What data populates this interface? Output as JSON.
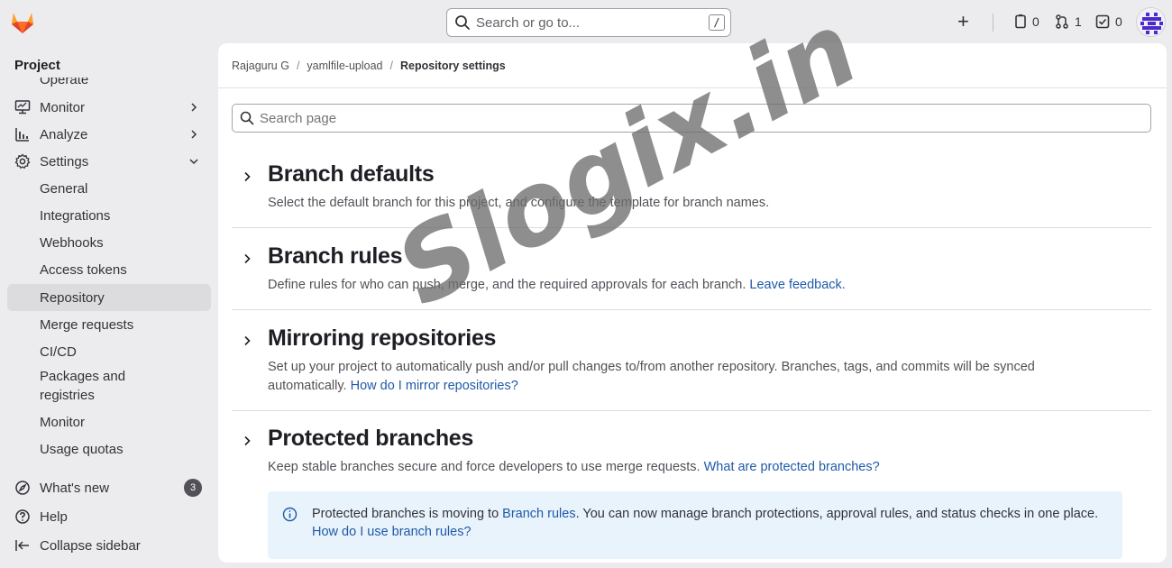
{
  "search": {
    "placeholder": "Search or go to...",
    "shortcut": "/"
  },
  "topbar": {
    "issues_count": "0",
    "merge_requests_count": "1",
    "todos_count": "0"
  },
  "sidebar": {
    "title": "Project",
    "clipped_item": "Operate",
    "items": [
      {
        "label": "Monitor",
        "icon": "monitor-icon",
        "chevron": "right"
      },
      {
        "label": "Analyze",
        "icon": "chart-icon",
        "chevron": "right"
      },
      {
        "label": "Settings",
        "icon": "gear-icon",
        "chevron": "down"
      }
    ],
    "sub_items": [
      "General",
      "Integrations",
      "Webhooks",
      "Access tokens",
      "Repository",
      "Merge requests",
      "CI/CD",
      "Packages and registries",
      "Monitor",
      "Usage quotas"
    ],
    "active": "Repository",
    "footer": [
      {
        "label": "What's new",
        "icon": "compass-icon",
        "badge": "3"
      },
      {
        "label": "Help",
        "icon": "help-icon"
      },
      {
        "label": "Collapse sidebar",
        "icon": "collapse-icon"
      }
    ]
  },
  "breadcrumb": [
    "Rajaguru G",
    "yamlfile-upload",
    "Repository settings"
  ],
  "page_search": {
    "placeholder": "Search page"
  },
  "sections": [
    {
      "title": "Branch defaults",
      "description": "Select the default branch for this project, and configure the template for branch names.",
      "link": ""
    },
    {
      "title": "Branch rules",
      "description": "Define rules for who can push, merge, and the required approvals for each branch.",
      "link": "Leave feedback."
    },
    {
      "title": "Mirroring repositories",
      "description": "Set up your project to automatically push and/or pull changes to/from another repository. Branches, tags, and commits will be synced automatically.",
      "link": "How do I mirror repositories?"
    },
    {
      "title": "Protected branches",
      "description": "Keep stable branches secure and force developers to use merge requests.",
      "link": "What are protected branches?"
    }
  ],
  "alert": {
    "text_before": "Protected branches is moving to ",
    "link1": "Branch rules",
    "text_after": ". You can now manage branch protections, approval rules, and status checks in one place.",
    "link2": "How do I use branch rules?"
  },
  "watermark": "Slogix.in",
  "colors": {
    "accent": "#1f5aa8",
    "alert_bg": "#e9f3fc",
    "active_bg": "#dcdcde",
    "logo": "#e24329"
  }
}
